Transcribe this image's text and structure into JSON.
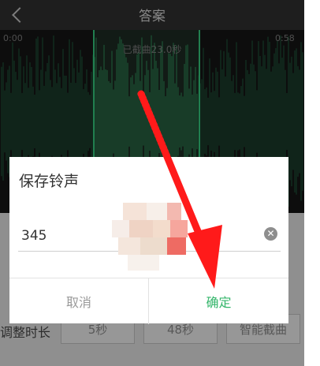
{
  "header": {
    "title": "答案"
  },
  "waveform": {
    "time_start": "0:00",
    "time_end": "0:58",
    "cut_label": "已截曲23.0秒"
  },
  "toolbar": {
    "adjust_label": "调整时长",
    "btn_5s": "5秒",
    "btn_48s": "48秒",
    "btn_smart": "智能截曲"
  },
  "dialog": {
    "title": "保存铃声",
    "input_value": "345",
    "cancel_label": "取消",
    "ok_label": "确定"
  },
  "icons": {
    "back": "chevron-left-icon",
    "clear": "clear-circle-icon"
  },
  "colors": {
    "accent_green": "#33b56a",
    "arrow_red": "#ff1a1a"
  }
}
